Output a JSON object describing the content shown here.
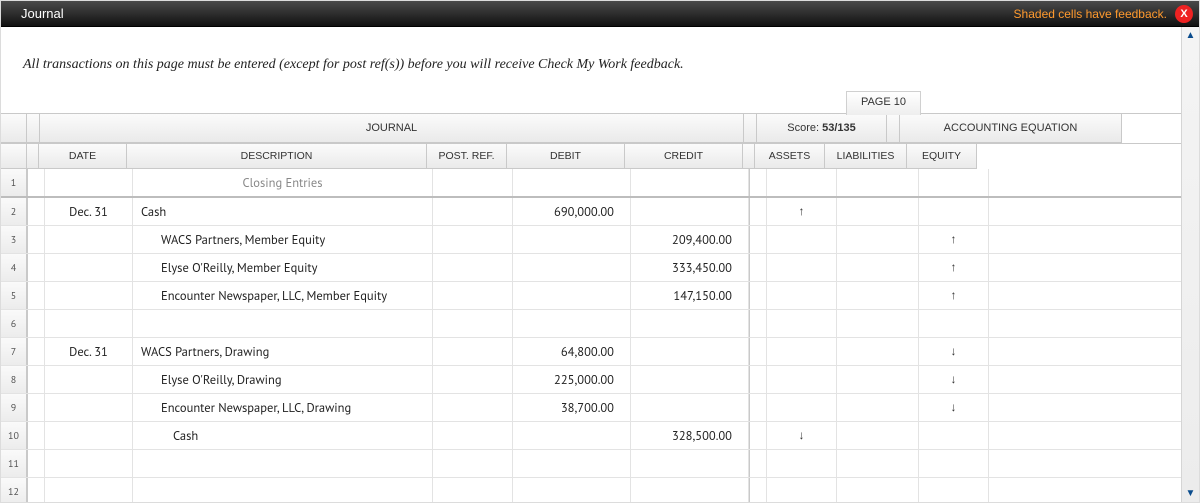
{
  "titlebar": {
    "title": "Journal",
    "feedback_note": "Shaded cells have feedback.",
    "close_glyph": "X"
  },
  "instruction": "All transactions on this page must be entered (except for post ref(s)) before you will receive Check My Work feedback.",
  "page_label": "PAGE 10",
  "header": {
    "journal": "JOURNAL",
    "score_label": "Score: ",
    "score_value": "53/135",
    "accounting_eq": "ACCOUNTING EQUATION"
  },
  "columns": {
    "date": "DATE",
    "description": "DESCRIPTION",
    "post_ref": "POST. REF.",
    "debit": "DEBIT",
    "credit": "CREDIT",
    "assets": "ASSETS",
    "liabilities": "LIABILITIES",
    "equity": "EQUITY"
  },
  "section_title": "Closing Entries",
  "rows": [
    {
      "n": "2",
      "date": "Dec. 31",
      "desc": "Cash",
      "indent": 0,
      "debit": "690,000.00",
      "credit": "",
      "assets": "↑",
      "liab": "",
      "equity": ""
    },
    {
      "n": "3",
      "date": "",
      "desc": "WACS Partners, Member Equity",
      "indent": 1,
      "debit": "",
      "credit": "209,400.00",
      "assets": "",
      "liab": "",
      "equity": "↑"
    },
    {
      "n": "4",
      "date": "",
      "desc": "Elyse O'Reilly, Member Equity",
      "indent": 1,
      "debit": "",
      "credit": "333,450.00",
      "assets": "",
      "liab": "",
      "equity": "↑"
    },
    {
      "n": "5",
      "date": "",
      "desc": "Encounter Newspaper, LLC, Member Equity",
      "indent": 1,
      "debit": "",
      "credit": "147,150.00",
      "assets": "",
      "liab": "",
      "equity": "↑"
    },
    {
      "n": "6",
      "date": "",
      "desc": "",
      "indent": 0,
      "debit": "",
      "credit": "",
      "assets": "",
      "liab": "",
      "equity": ""
    },
    {
      "n": "7",
      "date": "Dec. 31",
      "desc": "WACS Partners, Drawing",
      "indent": 0,
      "debit": "64,800.00",
      "credit": "",
      "assets": "",
      "liab": "",
      "equity": "↓"
    },
    {
      "n": "8",
      "date": "",
      "desc": "Elyse O'Reilly, Drawing",
      "indent": 1,
      "debit": "225,000.00",
      "credit": "",
      "assets": "",
      "liab": "",
      "equity": "↓"
    },
    {
      "n": "9",
      "date": "",
      "desc": "Encounter Newspaper, LLC, Drawing",
      "indent": 1,
      "debit": "38,700.00",
      "credit": "",
      "assets": "",
      "liab": "",
      "equity": "↓"
    },
    {
      "n": "10",
      "date": "",
      "desc": "Cash",
      "indent": 2,
      "debit": "",
      "credit": "328,500.00",
      "assets": "↓",
      "liab": "",
      "equity": ""
    },
    {
      "n": "11",
      "date": "",
      "desc": "",
      "indent": 0,
      "debit": "",
      "credit": "",
      "assets": "",
      "liab": "",
      "equity": ""
    },
    {
      "n": "12",
      "date": "",
      "desc": "",
      "indent": 0,
      "debit": "",
      "credit": "",
      "assets": "",
      "liab": "",
      "equity": ""
    }
  ]
}
